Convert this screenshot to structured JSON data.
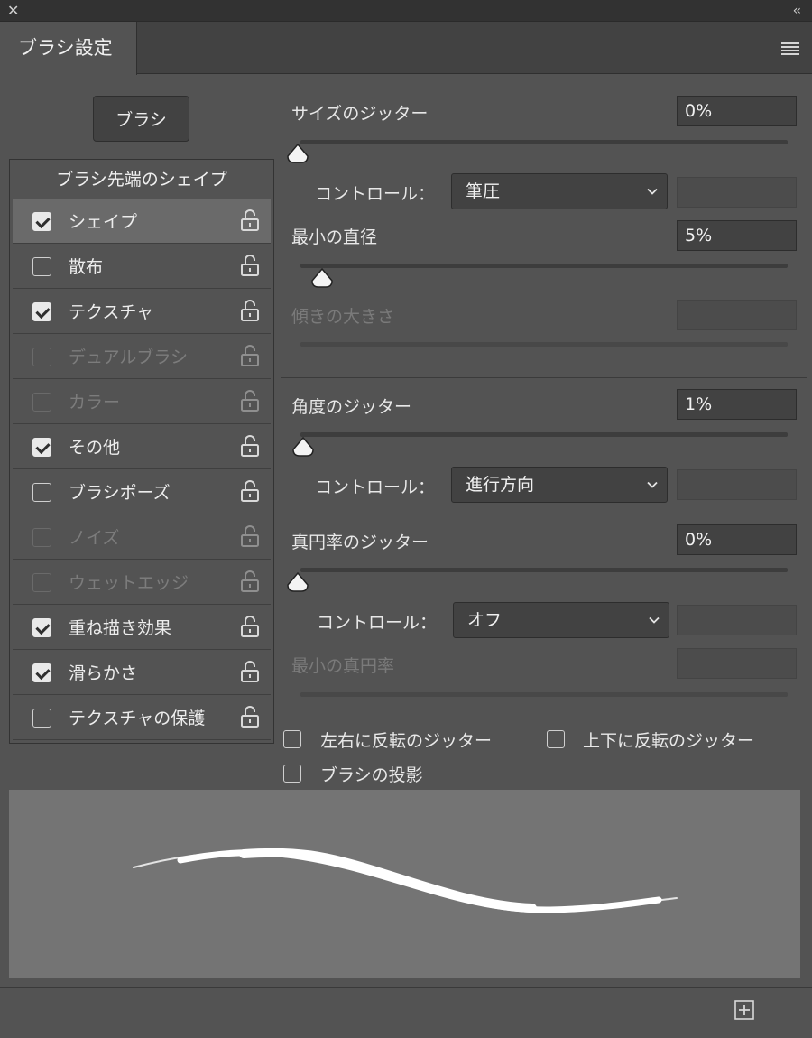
{
  "panel": {
    "title": "ブラシ設定",
    "close_glyph": "✕",
    "collapse_glyph": "‹‹",
    "menu_icon": "hamburger-menu-icon"
  },
  "brush_button": {
    "label": "ブラシ"
  },
  "list": {
    "title": "ブラシ先端のシェイプ",
    "items": [
      {
        "label": "シェイプ",
        "checked": true,
        "enabled": true,
        "selected": true
      },
      {
        "label": "散布",
        "checked": false,
        "enabled": true,
        "selected": false
      },
      {
        "label": "テクスチャ",
        "checked": true,
        "enabled": true,
        "selected": false
      },
      {
        "label": "デュアルブラシ",
        "checked": false,
        "enabled": false,
        "selected": false
      },
      {
        "label": "カラー",
        "checked": false,
        "enabled": false,
        "selected": false
      },
      {
        "label": "その他",
        "checked": true,
        "enabled": true,
        "selected": false
      },
      {
        "label": "ブラシポーズ",
        "checked": false,
        "enabled": true,
        "selected": false
      },
      {
        "label": "ノイズ",
        "checked": false,
        "enabled": false,
        "selected": false
      },
      {
        "label": "ウェットエッジ",
        "checked": false,
        "enabled": false,
        "selected": false
      },
      {
        "label": "重ね描き効果",
        "checked": true,
        "enabled": true,
        "selected": false
      },
      {
        "label": "滑らかさ",
        "checked": true,
        "enabled": true,
        "selected": false
      },
      {
        "label": "テクスチャの保護",
        "checked": false,
        "enabled": true,
        "selected": false
      }
    ],
    "lock_icon": "unlocked-padlock-icon"
  },
  "settings": {
    "size_jitter": {
      "label": "サイズのジッター",
      "value": "0%",
      "slider_percent": 0
    },
    "size_control": {
      "label": "コントロール：",
      "value": "筆圧"
    },
    "min_diameter": {
      "label": "最小の直径",
      "value": "5%",
      "slider_percent": 5
    },
    "tilt_scale": {
      "label": "傾きの大きさ",
      "value": "",
      "enabled": false
    },
    "angle_jitter": {
      "label": "角度のジッター",
      "value": "1%",
      "slider_percent": 1
    },
    "angle_control": {
      "label": "コントロール：",
      "value": "進行方向"
    },
    "roundness_jitter": {
      "label": "真円率のジッター",
      "value": "0%",
      "slider_percent": 0
    },
    "roundness_control": {
      "label": "コントロール：",
      "value": "オフ"
    },
    "min_roundness": {
      "label": "最小の真円率",
      "value": "",
      "enabled": false
    },
    "flip_x_jitter": {
      "label": "左右に反転のジッター",
      "checked": false
    },
    "flip_y_jitter": {
      "label": "上下に反転のジッター",
      "checked": false
    },
    "brush_projection": {
      "label": "ブラシの投影",
      "checked": false
    }
  },
  "footer": {
    "add_icon": "new-brush-plus-icon"
  },
  "colors": {
    "panel_bg": "#535353",
    "field_bg": "#424242",
    "preview_bg": "#747474",
    "text": "#e8e8e8",
    "disabled_text": "#7a7a7a"
  }
}
